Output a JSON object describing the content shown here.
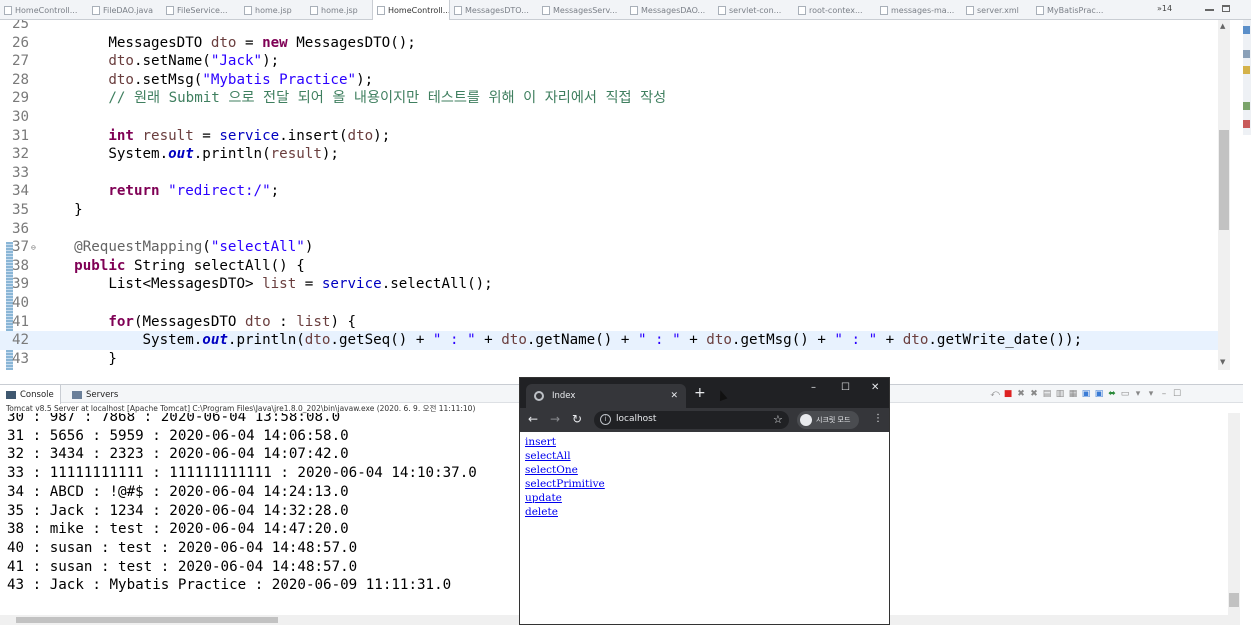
{
  "editor_tabs": [
    {
      "label": "HomeControll...",
      "active": false
    },
    {
      "label": "FileDAO.java",
      "active": false
    },
    {
      "label": "FileService...",
      "active": false
    },
    {
      "label": "home.jsp",
      "active": false
    },
    {
      "label": "home.jsp",
      "active": false
    },
    {
      "label": "HomeControll...",
      "active": true
    },
    {
      "label": "MessagesDTO...",
      "active": false
    },
    {
      "label": "MessagesServ...",
      "active": false
    },
    {
      "label": "MessagesDAO...",
      "active": false
    },
    {
      "label": "servlet-con...",
      "active": false
    },
    {
      "label": "root-contex...",
      "active": false
    },
    {
      "label": "messages-ma...",
      "active": false
    },
    {
      "label": "server.xml",
      "active": false
    },
    {
      "label": "MyBatisPrac...",
      "active": false
    }
  ],
  "tab_overflow": "»14",
  "code_lines": [
    {
      "n": "25",
      "segs": []
    },
    {
      "n": "26",
      "segs": [
        [
          "",
          "        MessagesDTO "
        ],
        [
          "var",
          "dto"
        ],
        [
          "",
          " = "
        ],
        [
          "kw",
          "new"
        ],
        [
          "",
          " MessagesDTO();"
        ]
      ]
    },
    {
      "n": "27",
      "segs": [
        [
          "var",
          "        dto"
        ],
        [
          "",
          ".setName("
        ],
        [
          "str",
          "\"Jack\""
        ],
        [
          "",
          ");"
        ]
      ]
    },
    {
      "n": "28",
      "segs": [
        [
          "var",
          "        dto"
        ],
        [
          "",
          ".setMsg("
        ],
        [
          "str",
          "\"Mybatis Practice\""
        ],
        [
          "",
          ");"
        ]
      ]
    },
    {
      "n": "29",
      "segs": [
        [
          "cmt",
          "        // 원래 Submit 으로 전달 되어 올 내용이지만 테스트를 위해 이 자리에서 직접 작성"
        ]
      ]
    },
    {
      "n": "30",
      "segs": []
    },
    {
      "n": "31",
      "segs": [
        [
          "kw",
          "        int"
        ],
        [
          "",
          " "
        ],
        [
          "var",
          "result"
        ],
        [
          "",
          " = "
        ],
        [
          "fld",
          "service"
        ],
        [
          "",
          ".insert("
        ],
        [
          "var",
          "dto"
        ],
        [
          "",
          ");"
        ]
      ]
    },
    {
      "n": "32",
      "segs": [
        [
          "",
          "        System."
        ],
        [
          "st",
          "out"
        ],
        [
          "",
          ".println("
        ],
        [
          "var",
          "result"
        ],
        [
          "",
          ");"
        ]
      ]
    },
    {
      "n": "33",
      "segs": []
    },
    {
      "n": "34",
      "segs": [
        [
          "kw",
          "        return"
        ],
        [
          "",
          " "
        ],
        [
          "str",
          "\"redirect:/\""
        ],
        [
          "",
          ";"
        ]
      ]
    },
    {
      "n": "35",
      "segs": [
        [
          "",
          "    }"
        ]
      ]
    },
    {
      "n": "36",
      "segs": []
    },
    {
      "n": "37",
      "fold": "⊖",
      "segs": [
        [
          "ann",
          "    @RequestMapping"
        ],
        [
          "",
          "("
        ],
        [
          "str",
          "\"selectAll\""
        ],
        [
          "",
          ")"
        ]
      ]
    },
    {
      "n": "38",
      "segs": [
        [
          "kw",
          "    public"
        ],
        [
          "",
          " String selectAll() {"
        ]
      ]
    },
    {
      "n": "39",
      "segs": [
        [
          "",
          "        List<MessagesDTO> "
        ],
        [
          "var",
          "list"
        ],
        [
          "",
          " = "
        ],
        [
          "fld",
          "service"
        ],
        [
          "",
          ".selectAll();"
        ]
      ]
    },
    {
      "n": "40",
      "segs": []
    },
    {
      "n": "41",
      "segs": [
        [
          "kw",
          "        for"
        ],
        [
          "",
          "(MessagesDTO "
        ],
        [
          "var",
          "dto"
        ],
        [
          "",
          " : "
        ],
        [
          "var",
          "list"
        ],
        [
          "",
          ") {"
        ]
      ]
    },
    {
      "n": "42",
      "segs": [
        [
          "",
          "            System."
        ],
        [
          "st",
          "out"
        ],
        [
          "",
          ".println("
        ],
        [
          "var",
          "dto"
        ],
        [
          "",
          ".getSeq() + "
        ],
        [
          "str",
          "\" : \""
        ],
        [
          "",
          " + "
        ],
        [
          "var",
          "dto"
        ],
        [
          "",
          ".getName() + "
        ],
        [
          "str",
          "\" : \""
        ],
        [
          "",
          " + "
        ],
        [
          "var",
          "dto"
        ],
        [
          "",
          ".getMsg() + "
        ],
        [
          "str",
          "\" : \""
        ],
        [
          "",
          " + "
        ],
        [
          "var",
          "dto"
        ],
        [
          "",
          ".getWrite_date());"
        ]
      ]
    },
    {
      "n": "43",
      "segs": [
        [
          "",
          "        }"
        ]
      ]
    }
  ],
  "console": {
    "tab_console": "Console",
    "tab_servers": "Servers",
    "description": "Tomcat v8.5 Server at localhost [Apache Tomcat] C:\\Program Files\\Java\\jre1.8.0_202\\bin\\javaw.exe (2020. 6. 9. 오전 11:11:10)",
    "lines": [
      "30 : 987 : 7868 : 2020-06-04 13:58:08.0",
      "31 : 5656 : 5959 : 2020-06-04 14:06:58.0",
      "32 : 3434 : 2323 : 2020-06-04 14:07:42.0",
      "33 : 11111111111 : 111111111111 : 2020-06-04 14:10:37.0",
      "34 : ABCD : !@#$ : 2020-06-04 14:24:13.0",
      "35 : Jack : 1234 : 2020-06-04 14:32:28.0",
      "38 : mike : test : 2020-06-04 14:47:20.0",
      "40 : susan : test : 2020-06-04 14:48:57.0",
      "41 : susan : test : 2020-06-04 14:48:57.0",
      "43 : Jack : Mybatis Practice : 2020-06-09 11:11:31.0"
    ]
  },
  "browser": {
    "tab_title": "Index",
    "tab_close": "✕",
    "new_tab": "+",
    "minimize": "–",
    "maximize": "☐",
    "close": "✕",
    "back": "←",
    "forward": "→",
    "reload": "↻",
    "info": "i",
    "url": "localhost",
    "star": "☆",
    "incognito_label": "시크릿 모드",
    "menu": "⋮",
    "links": [
      "insert",
      "selectAll",
      "selectOne",
      "selectPrimitive",
      "update",
      "delete"
    ]
  },
  "colors": {
    "keyword": "#7f0055",
    "string": "#2a00ff",
    "comment": "#3f7f5f",
    "link": "#0000ee",
    "chrome_dark": "#202124"
  }
}
